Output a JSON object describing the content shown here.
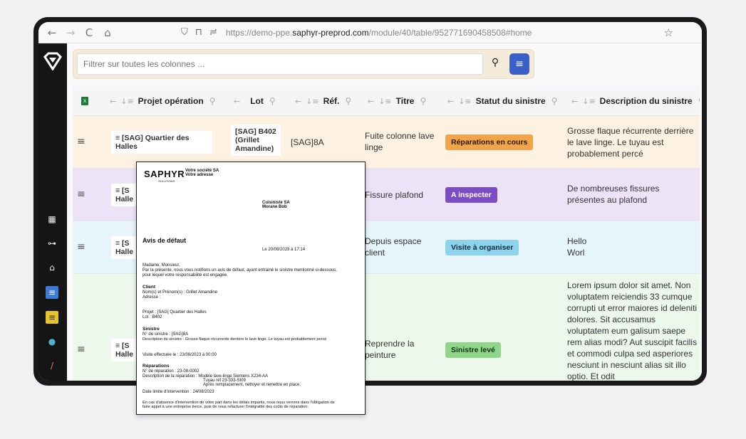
{
  "browser": {
    "back": "←",
    "forward": "→",
    "reload": "C",
    "home": "⌂",
    "url_prefix": "https://demo-ppe.",
    "url_domain": "saphyr-preprod.com",
    "url_path": "/module/40/table/952771690458508#home",
    "star": "☆"
  },
  "filter": {
    "placeholder": "Filtrer sur toutes les colonnes ...",
    "search_icon": "search-icon",
    "menu_icon": "list-icon"
  },
  "columns": [
    {
      "label": "Projet opération"
    },
    {
      "label": "Lot"
    },
    {
      "label": "Réf."
    },
    {
      "label": "Titre"
    },
    {
      "label": "Statut du sinistre"
    },
    {
      "label": "Description du sinistre"
    }
  ],
  "rows": [
    {
      "projet": "[SAG] Quartier des Halles",
      "lot": "[SAG] B402 (Grillet Amandine)",
      "ref": "[SAG]8A",
      "titre": "Fuite colonne lave linge",
      "statut": "Réparations en cours",
      "statut_color": "#f2a44a",
      "description": "Grosse flaque récurrente derrière le lave linge. Le tuyau est probablement percé",
      "row_bg": "#fdf2e1"
    },
    {
      "projet": "[S Halle",
      "titre": "Fissure plafond",
      "statut": "A inspecter",
      "statut_color": "#7b4cc4",
      "description": "De nombreuses fissures présentes au plafond",
      "row_bg": "#ece3f8"
    },
    {
      "projet": "[S Halle",
      "titre": "Depuis espace client",
      "statut": "Visite à organiser",
      "statut_color": "#8ed3ee",
      "description": "Hello Worl",
      "row_bg": "#e6f5fb"
    },
    {
      "projet": "[S Halle",
      "titre": "Reprendre la peinture",
      "statut": "Sinistre levé",
      "statut_color": "#8fd68b",
      "description": "Lorem ipsum dolor sit amet. Non voluptatem reiciendis 33 cumque corrupti ut error maiores id deleniti dolores. Sit accusamus voluptatem eum galisum saepe rem alias modi? Aut suscipit facilis et commodi culpa sed asperiores nesciunt in nesciunt alias sit illo optio. Et odit",
      "row_bg": "#edf8ec"
    }
  ],
  "document": {
    "logo": "SAPHYR",
    "logo_sub": "SOLUTIONS",
    "company": "Votre société SA",
    "company_address": "Votre adresse",
    "recipient_name": "Cuisiniste SA",
    "recipient_contact": "Morane Bob",
    "title": "Avis de défaut",
    "date": "Le  20/08/2023 à 17:14",
    "greeting": "Madame, Monsieur,",
    "intro1": "Par la présente, nous vous notifions un avis de défaut, ayant entrainé le sinistre mentionné ci-dessous,",
    "intro2": "pour lequel votre responsabilité est engagée.",
    "client_heading": "Client",
    "client_name": "Nom(s) et Prénom(s) :  Grillet Amandine",
    "client_address": "Adresse :",
    "projet": "Projet :  [SAG] Quartier des Halles",
    "lot": "Lot :  B402",
    "sinistre_heading": "Sinistre",
    "sinistre_num": "N° de sinistre :   [SAG]8A",
    "sinistre_desc": "Description du sinistre :  Grosse flaque récurrente derrière le lave linge. Le tuyau est probablement percé",
    "visite": "Visite effectuée le :  23/08/2023 à 00:00",
    "reparations_heading": "Réparations",
    "rep_num": "N° de réparation :  23-08-0002",
    "rep_desc1": "Description de la réparation :  Modèle lave-linge Siemens X234-AA",
    "rep_desc2": "Tuyau réf 23-333-SI09",
    "rep_desc3": "Après remplacement, nettoyer et remettre en place.",
    "deadline": "Date limite d'intervention :  24/08/2023",
    "footer1": "En cas d'absence d'intervention de votre part dans les délais impartis, nous nous verrons dans l'obligation de",
    "footer2": "faire appel à une entreprise tierce, puis de vous refacturer l'intégralité des coûts de réparation."
  }
}
